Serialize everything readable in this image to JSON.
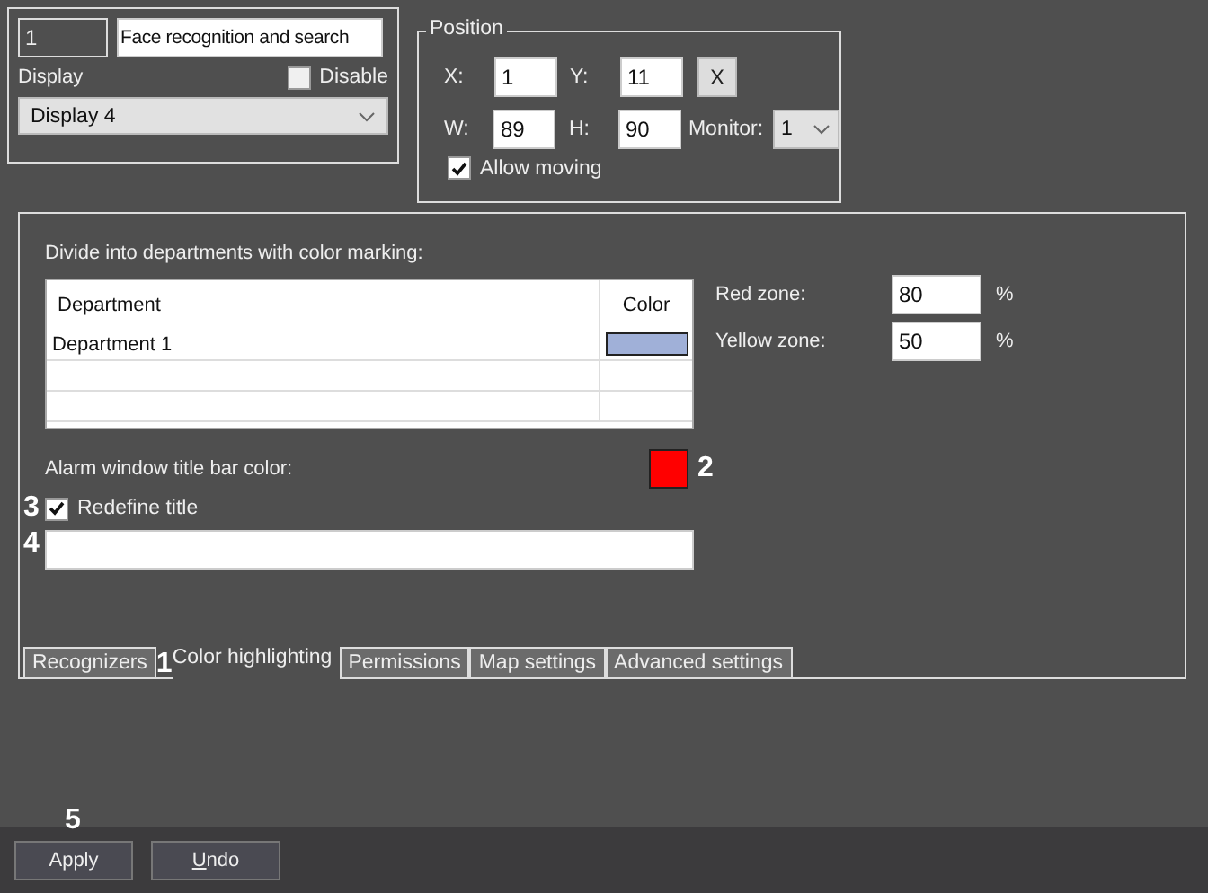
{
  "general": {
    "number": "1",
    "name": "Face recognition and search",
    "display_label": "Display",
    "disable": {
      "label": "Disable",
      "checked": false
    },
    "display_select": "Display 4"
  },
  "position": {
    "title": "Position",
    "fields": [
      {
        "label": "X:",
        "value": "1"
      },
      {
        "label": "Y:",
        "value": "11"
      },
      {
        "label": "W:",
        "value": "89"
      },
      {
        "label": "H:",
        "value": "90"
      }
    ],
    "clear_button": "X",
    "monitor_label": "Monitor:",
    "monitor_select": "1",
    "allow_moving": {
      "label": "Allow moving",
      "checked": true
    }
  },
  "color_highlighting": {
    "heading": "Divide into departments with color marking:",
    "table": {
      "columns": [
        "Department",
        "Color"
      ],
      "rows": [
        {
          "department": "Department 1",
          "color": "#a0b0d8"
        }
      ]
    },
    "zones": [
      {
        "label": "Red zone:",
        "value": "80",
        "unit": "%"
      },
      {
        "label": "Yellow zone:",
        "value": "50",
        "unit": "%"
      }
    ],
    "alarm": {
      "label": "Alarm window title bar color:",
      "color": "#ff0000",
      "callout": "2"
    },
    "redefine_title": {
      "label": "Redefine title",
      "checked": true,
      "callout": "3"
    },
    "title_field": {
      "callout": "4"
    }
  },
  "tabs": [
    {
      "label": "Recognizers",
      "selected": false
    },
    {
      "label": "Color highlighting",
      "selected": true,
      "callout": "1"
    },
    {
      "label": "Permissions",
      "selected": false
    },
    {
      "label": "Map settings",
      "selected": false
    },
    {
      "label": "Advanced settings",
      "selected": false
    }
  ],
  "buttons": [
    {
      "label": "Apply",
      "underline_first": false,
      "callout": "5"
    },
    {
      "label": "Undo",
      "underline_first": true
    }
  ]
}
